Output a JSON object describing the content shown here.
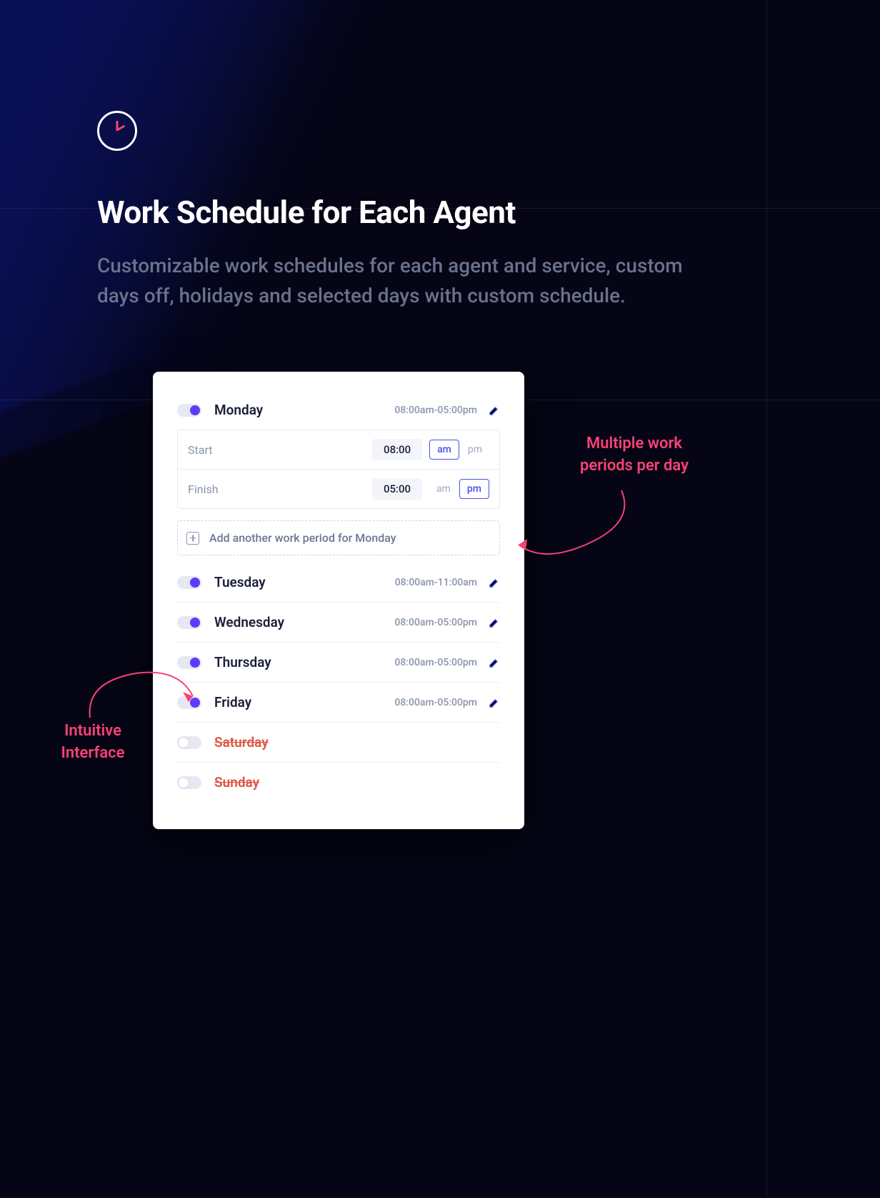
{
  "page": {
    "title": "Work Schedule for Each Agent",
    "subtitle": "Customizable work schedules for each agent and service, custom days off, holidays and selected days with custom schedule."
  },
  "callouts": {
    "right": "Multiple work\nperiods per day",
    "left": "Intuitive\nInterface"
  },
  "schedule": {
    "expanded_day": {
      "name": "Monday",
      "summary": "08:00am-05:00pm",
      "start_label": "Start",
      "start_time": "08:00",
      "start_ampm": "am",
      "finish_label": "Finish",
      "finish_time": "05:00",
      "finish_ampm": "pm",
      "add_label": "Add another work period for Monday"
    },
    "days": [
      {
        "name": "Tuesday",
        "summary": "08:00am-11:00am",
        "enabled": true
      },
      {
        "name": "Wednesday",
        "summary": "08:00am-05:00pm",
        "enabled": true
      },
      {
        "name": "Thursday",
        "summary": "08:00am-05:00pm",
        "enabled": true
      },
      {
        "name": "Friday",
        "summary": "08:00am-05:00pm",
        "enabled": true
      },
      {
        "name": "Saturday",
        "enabled": false
      },
      {
        "name": "Sunday",
        "enabled": false
      }
    ],
    "am": "am",
    "pm": "pm"
  }
}
